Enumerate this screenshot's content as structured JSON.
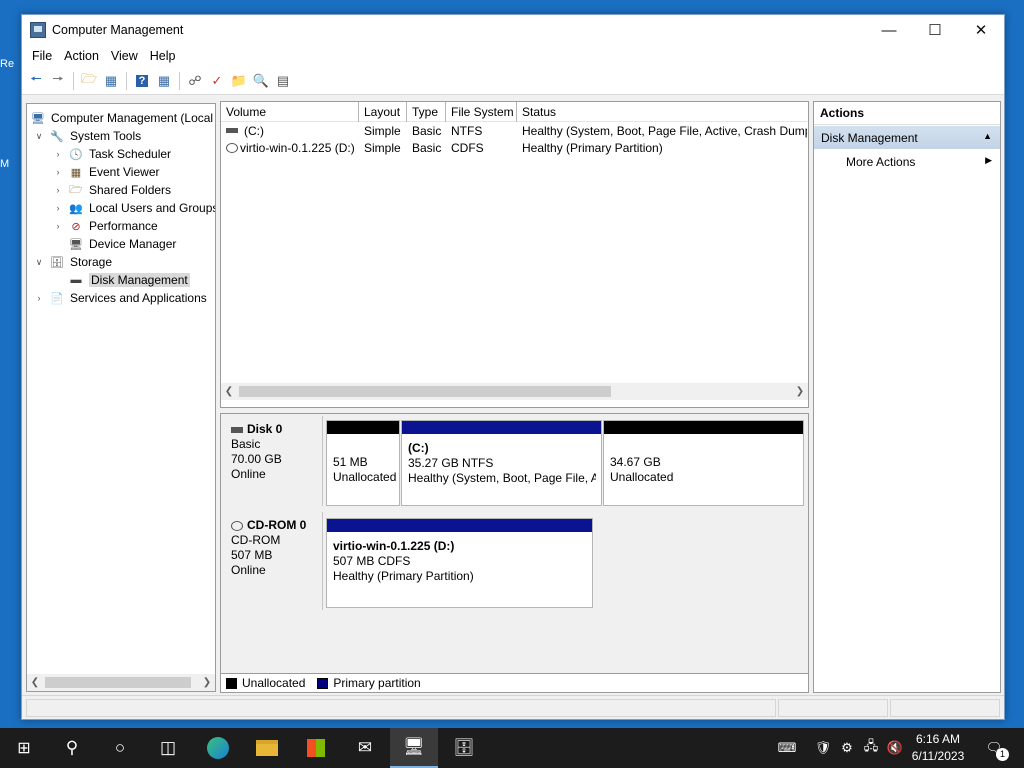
{
  "window": {
    "title": "Computer Management"
  },
  "menu": [
    "File",
    "Action",
    "View",
    "Help"
  ],
  "tree": {
    "root": "Computer Management (Local",
    "items": [
      {
        "label": "System Tools"
      },
      {
        "label": "Task Scheduler"
      },
      {
        "label": "Event Viewer"
      },
      {
        "label": "Shared Folders"
      },
      {
        "label": "Local Users and Groups"
      },
      {
        "label": "Performance"
      },
      {
        "label": "Device Manager"
      },
      {
        "label": "Storage"
      },
      {
        "label": "Disk Management"
      },
      {
        "label": "Services and Applications"
      }
    ]
  },
  "volumes": {
    "columns": [
      "Volume",
      "Layout",
      "Type",
      "File System",
      "Status"
    ],
    "rows": [
      [
        "(C:)",
        "Simple",
        "Basic",
        "NTFS",
        "Healthy (System, Boot, Page File, Active, Crash Dump,"
      ],
      [
        "virtio-win-0.1.225 (D:)",
        "Simple",
        "Basic",
        "CDFS",
        "Healthy (Primary Partition)"
      ]
    ]
  },
  "disks": [
    {
      "name": "Disk 0",
      "type": "Basic",
      "size": "70.00 GB",
      "state": "Online",
      "partitions": [
        {
          "title": "",
          "line1": "51 MB",
          "line2": "Unallocated",
          "kind": "unallocated"
        },
        {
          "title": "(C:)",
          "line1": "35.27 GB NTFS",
          "line2": "Healthy (System, Boot, Page File, Ac",
          "kind": "primary"
        },
        {
          "title": "",
          "line1": "34.67 GB",
          "line2": "Unallocated",
          "kind": "unallocated"
        }
      ]
    },
    {
      "name": "CD-ROM 0",
      "type": "CD-ROM",
      "size": "507 MB",
      "state": "Online",
      "partitions": [
        {
          "title": "virtio-win-0.1.225  (D:)",
          "line1": "507 MB CDFS",
          "line2": "Healthy (Primary Partition)",
          "kind": "primary"
        }
      ]
    }
  ],
  "legend": [
    {
      "label": "Unallocated",
      "color": "#000000"
    },
    {
      "label": "Primary partition",
      "color": "#00007f"
    }
  ],
  "actions": {
    "header": "Actions",
    "section": "Disk Management",
    "item": "More Actions"
  },
  "clock": {
    "time": "6:16 AM",
    "date": "6/11/2023"
  },
  "notification_count": "1",
  "colors": {
    "primary_bar": "#0a1390",
    "unallocated_bar": "#000000",
    "desktop": "#1a6fc2",
    "taskbar": "#1c1c1c"
  }
}
